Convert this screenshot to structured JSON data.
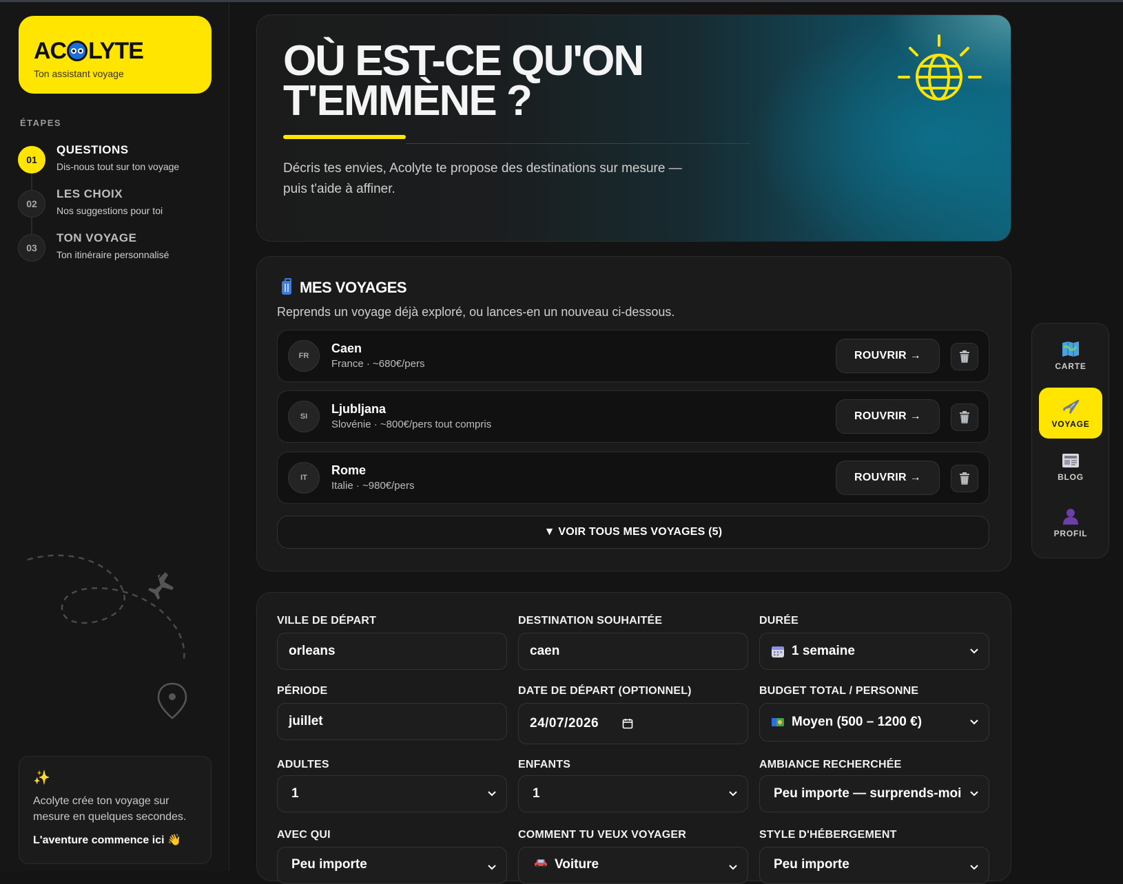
{
  "sidebar": {
    "logo": {
      "title_start": "AC",
      "title_end": "LYTE",
      "subtitle": "Ton assistant voyage"
    },
    "steps_heading": "ÉTAPES",
    "steps": [
      {
        "num": "01",
        "title": "QUESTIONS",
        "subtitle": "Dis-nous tout sur ton voyage",
        "active": true
      },
      {
        "num": "02",
        "title": "LES CHOIX",
        "subtitle": "Nos suggestions pour toi",
        "active": false
      },
      {
        "num": "03",
        "title": "TON VOYAGE",
        "subtitle": "Ton itinéraire personnalisé",
        "active": false
      }
    ],
    "card": {
      "icon": "sparkles-icon",
      "text": "Acolyte crée ton voyage sur mesure en quelques secondes.",
      "cta": "L'aventure commence ici 👋"
    }
  },
  "hero": {
    "title_line1": "OÙ EST-CE QU'ON",
    "title_line2": "T'EMMÈNE ?",
    "description": "Décris tes envies, Acolyte te propose des destinations sur mesure — puis t'aide à affiner.",
    "icon": "globe-icon"
  },
  "voyages": {
    "title": "MES VOYAGES",
    "subtitle": "Reprends un voyage déjà exploré, ou lances-en un nouveau ci-dessous.",
    "reopen_label": "ROUVRIR →",
    "trips": [
      {
        "code": "FR",
        "city": "Caen",
        "info": "France · ~680€/pers"
      },
      {
        "code": "SI",
        "city": "Ljubljana",
        "info": "Slovénie · ~800€/pers tout compris"
      },
      {
        "code": "IT",
        "city": "Rome",
        "info": "Italie · ~980€/pers"
      }
    ],
    "see_all": "▼ VOIR TOUS MES VOYAGES (5)"
  },
  "form": {
    "depart": {
      "label": "VILLE DE DÉPART",
      "value": "orleans"
    },
    "destination": {
      "label": "DESTINATION SOUHAITÉE",
      "value": "caen"
    },
    "duree": {
      "label": "DURÉE",
      "value": "1 semaine"
    },
    "periode": {
      "label": "PÉRIODE",
      "value": "juillet"
    },
    "date": {
      "label": "DATE DE DÉPART (OPTIONNEL)",
      "value": "24/07/2026"
    },
    "budget": {
      "label": "BUDGET TOTAL / PERSONNE",
      "value": "Moyen (500 – 1200 €)"
    },
    "adultes": {
      "label": "ADULTES",
      "value": "1"
    },
    "enfants": {
      "label": "ENFANTS",
      "value": "1"
    },
    "ambiance": {
      "label": "AMBIANCE RECHERCHÉE",
      "value": "Peu importe — surprends-moi"
    },
    "avec_qui": {
      "label": "AVEC QUI",
      "value": "Peu importe"
    },
    "transport": {
      "label": "COMMENT TU VEUX VOYAGER",
      "value": "Voiture"
    },
    "hebergement": {
      "label": "STYLE D'HÉBERGEMENT",
      "value": "Peu importe"
    }
  },
  "rnav": [
    {
      "label": "CARTE",
      "icon": "map-icon",
      "active": false
    },
    {
      "label": "VOYAGE",
      "icon": "airplane-icon",
      "active": true
    },
    {
      "label": "BLOG",
      "icon": "newspaper-icon",
      "active": false
    },
    {
      "label": "PROFIL",
      "icon": "user-icon",
      "active": false
    }
  ],
  "colors": {
    "accent": "#ffe500",
    "background": "#141414",
    "card": "#1b1b1b"
  }
}
